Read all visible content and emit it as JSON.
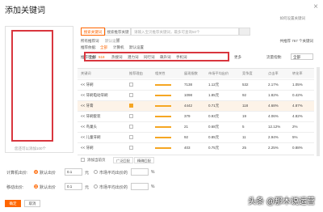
{
  "dialog": {
    "title": "添加关键词",
    "help": "如何设置关键词",
    "close": "×"
  },
  "left": {
    "footer": "您还可以添加100个"
  },
  "search": {
    "tab_active": "搜索关键词",
    "tab_other": "搜索推荐关键词",
    "placeholder": "请输入宝贝推荐关键词，最多可查询50个"
  },
  "filters": {
    "label1": "所有推荐词",
    "opt1": "默认设置",
    "label2": "推荐依据:",
    "opt2a": "全部",
    "opt2b": "计算机",
    "opt2c": "默认设置",
    "label3": "推荐理由:",
    "chips": [
      "全部",
      "518",
      "热搜词",
      "潜力词",
      "同行词",
      "飙升词",
      "手机词"
    ],
    "more": "更多",
    "right_info": "共推荐 767 个关键词",
    "sort_label": "流量指数:",
    "sort_value": "全部"
  },
  "table": {
    "headers": [
      "关键词",
      "推荐理由",
      "相关性",
      "展现指数",
      "市场平均出价",
      "竞争度",
      "点击率",
      "转化率"
    ],
    "rows": [
      {
        "kw": "<< 牙刷",
        "price": "7138",
        "bid": "1.12元",
        "comp": "532",
        "ctr": "2.17%",
        "cvr": "1.05%",
        "checked": false
      },
      {
        "kw": "<< 牙刷电动牙刷",
        "price": "1098",
        "bid": "1.85元",
        "comp": "92",
        "ctr": "1.82%",
        "cvr": "0.42%",
        "checked": false
      },
      {
        "kw": "<< 牙膏",
        "price": "4442",
        "bid": "0.71元",
        "comp": "118",
        "ctr": "4.68%",
        "cvr": "4.87%",
        "checked": true
      },
      {
        "kw": "<< 牙刷套装",
        "price": "379",
        "bid": "0.93元",
        "comp": "19",
        "ctr": "4.06%",
        "cvr": "4.82%",
        "checked": false
      },
      {
        "kw": "<< 鸟巢头",
        "price": "21",
        "bid": "0.68元",
        "comp": "5",
        "ctr": "12.12%",
        "cvr": "2%",
        "checked": false
      },
      {
        "kw": "<< 儿童牙刷",
        "price": "92",
        "bid": "0.85元",
        "comp": "11",
        "ctr": "2.94%",
        "cvr": "5%",
        "checked": false
      },
      {
        "kw": "<< 牙刷",
        "price": "403",
        "bid": "0.75元",
        "comp": "25",
        "ctr": "2.25%",
        "cvr": "0.88%",
        "checked": false
      }
    ]
  },
  "table_footer": {
    "add_all": "添加当前页",
    "btn1": "广泛匹配",
    "btn2": "精确匹配"
  },
  "form": {
    "row1_label": "计算机出价:",
    "row1_opt1": "默认出价",
    "row1_value": "0.1",
    "row1_unit": "元",
    "row1_opt2": "市场平均出价的",
    "row1_pct": "%",
    "row2_label": "移动出价:",
    "row2_opt1": "默认出价",
    "row2_value": "0.1",
    "row2_unit": "元",
    "row2_opt2": "市场平均出价的",
    "row2_pct": "%"
  },
  "footer": {
    "ok": "确定",
    "cancel": "取消"
  },
  "watermark": "头条 @那木说运营"
}
